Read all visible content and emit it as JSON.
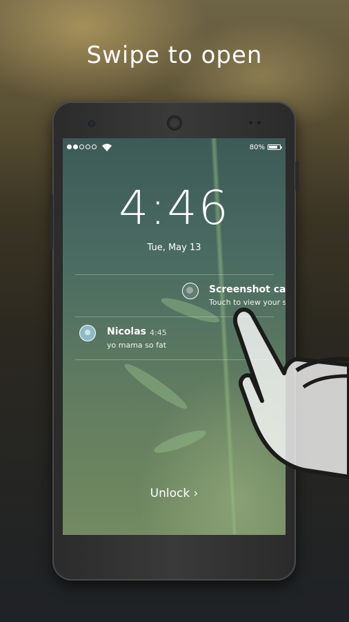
{
  "headline": "Swipe to open",
  "status_bar": {
    "signal_dots_filled": 2,
    "signal_dots_total": 5,
    "battery_percent": "80%",
    "battery_level": 0.8
  },
  "lockscreen": {
    "time": "4:46",
    "date": "Tue, May 13",
    "unlock_label": "Unlock ›"
  },
  "notifications": [
    {
      "title": "Screenshot cap",
      "subtitle": "Touch to view your s",
      "icon": "screenshot-icon"
    },
    {
      "title": "Nicolas",
      "time": "4:45",
      "subtitle": "yo mama so fat",
      "icon": "contact-avatar"
    }
  ],
  "colors": {
    "text": "#ffffff",
    "avatar_accent": "#8fb9c6"
  }
}
